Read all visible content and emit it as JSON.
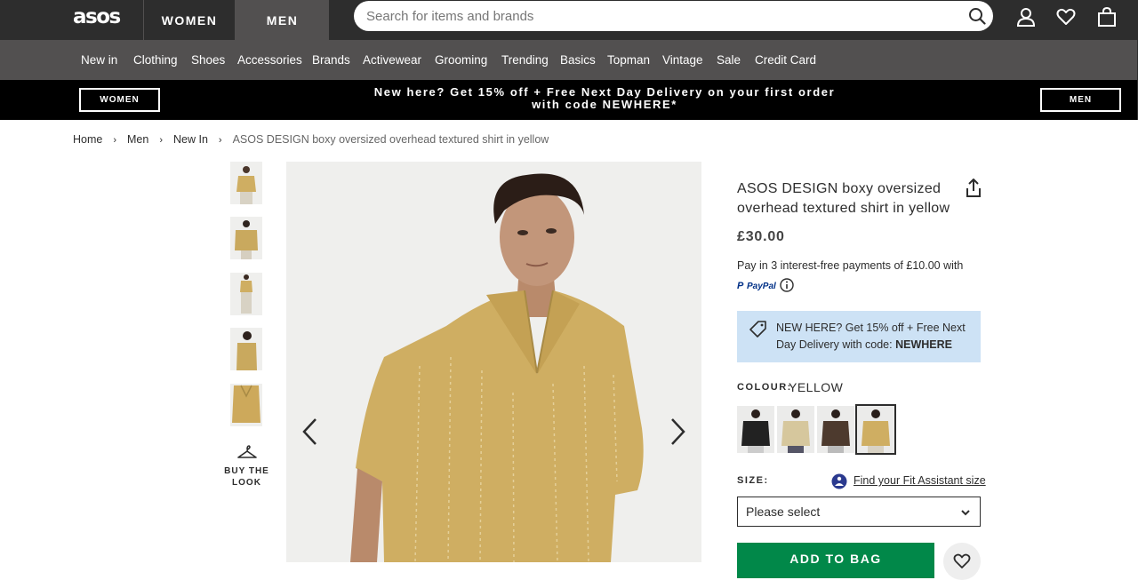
{
  "header": {
    "logo": "asos",
    "tabs": [
      "WOMEN",
      "MEN"
    ],
    "search_placeholder": "Search for items and brands",
    "icons": [
      "search-icon",
      "account-icon",
      "heart-icon",
      "bag-icon"
    ]
  },
  "nav": {
    "items": [
      "New in",
      "Clothing",
      "Shoes",
      "Accessories",
      "Brands",
      "Activewear",
      "Grooming",
      "Trending",
      "Basics",
      "Topman",
      "Vintage",
      "Sale",
      "Credit Card"
    ]
  },
  "promo": {
    "left_button": "WOMEN",
    "right_button": "MEN",
    "line1": "New here? Get 15% off + Free Next Day Delivery on your first order",
    "line2": "with code NEWHERE*"
  },
  "breadcrumb": {
    "items": [
      "Home",
      "Men",
      "New In"
    ],
    "separator": "›",
    "current": "ASOS DESIGN boxy oversized overhead textured shirt in yellow"
  },
  "gallery": {
    "buy_the_look": "BUY THE LOOK"
  },
  "product": {
    "title": "ASOS DESIGN boxy oversized overhead textured shirt in yellow",
    "price": "£30.00",
    "pay_text": "Pay in 3 interest-free payments of £10.00 with",
    "paypal_label": "PayPal",
    "promo_text": "NEW HERE? Get 15% off + Free Next Day Delivery with code: ",
    "promo_code": "NEWHERE",
    "colour_label": "COLOUR:",
    "colour_value": "YELLOW",
    "size_label": "SIZE:",
    "fit_link": "Find your Fit Assistant size",
    "size_select": "Please select",
    "add_to_bag": "ADD TO BAG"
  },
  "colors": {
    "header_bg": "#2d2d2d",
    "nav_bg": "#525050",
    "promo_bg": "#000000",
    "promo_box_bg": "#cde2f5",
    "add_bag_bg": "#018849",
    "shirt_yellow": "#cfae62"
  }
}
